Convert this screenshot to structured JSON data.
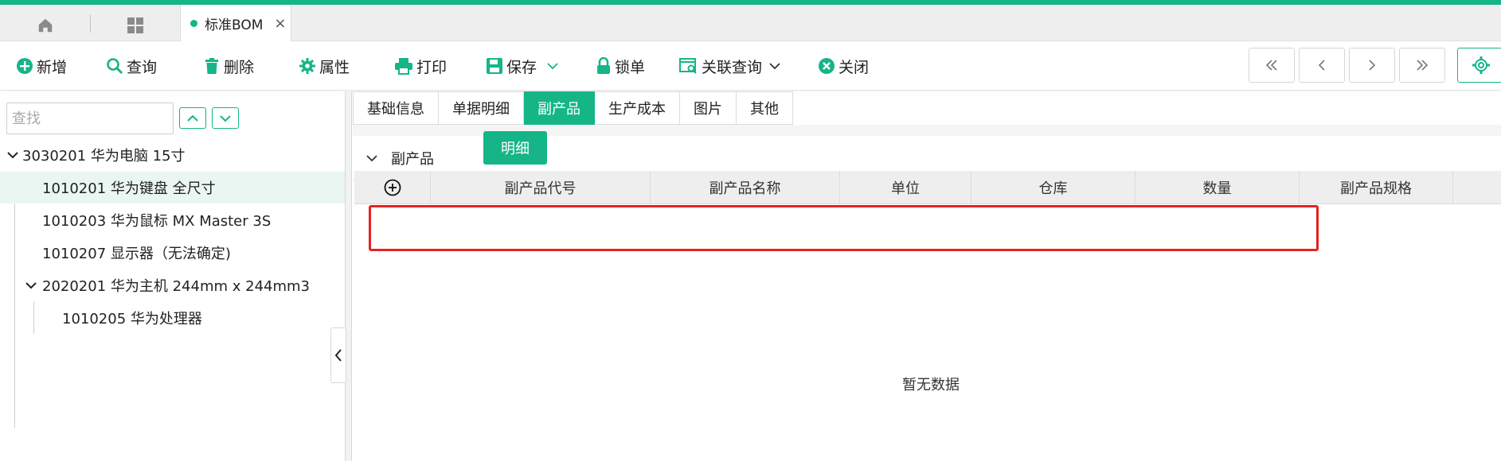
{
  "window": {
    "active_tab": "标准BOM",
    "close_glyph": "×"
  },
  "toolbar": {
    "new": "新增",
    "query": "查询",
    "delete": "删除",
    "properties": "属性",
    "print": "打印",
    "save": "保存",
    "lock": "锁单",
    "related_query": "关联查询",
    "close": "关闭"
  },
  "left": {
    "search_placeholder": "查找",
    "tree": [
      {
        "label": "3030201 华为电脑 15寸",
        "level": 0,
        "expanded": true,
        "selected": false
      },
      {
        "label": "1010201 华为键盘 全尺寸",
        "level": 1,
        "expanded": false,
        "selected": true
      },
      {
        "label": "1010203 华为鼠标 MX Master 3S",
        "level": 1,
        "expanded": false,
        "selected": false
      },
      {
        "label": "1010207 显示器（无法确定)",
        "level": 1,
        "expanded": false,
        "selected": false
      },
      {
        "label": "2020201 华为主机 244mm x 244mm3",
        "level": 1,
        "expanded": true,
        "selected": false
      },
      {
        "label": "1010205 华为处理器",
        "level": 2,
        "expanded": false,
        "selected": false
      }
    ]
  },
  "right": {
    "tabs": [
      "基础信息",
      "单据明细",
      "副产品",
      "生产成本",
      "图片",
      "其他"
    ],
    "active_tab_index": 2,
    "section_label": "副产品",
    "detail_button": "明细",
    "columns": [
      "副产品代号",
      "副产品名称",
      "单位",
      "仓库",
      "数量",
      "副产品规格"
    ],
    "empty_text": "暂无数据"
  },
  "colors": {
    "accent": "#15b587",
    "highlight_box": "#e42320"
  }
}
